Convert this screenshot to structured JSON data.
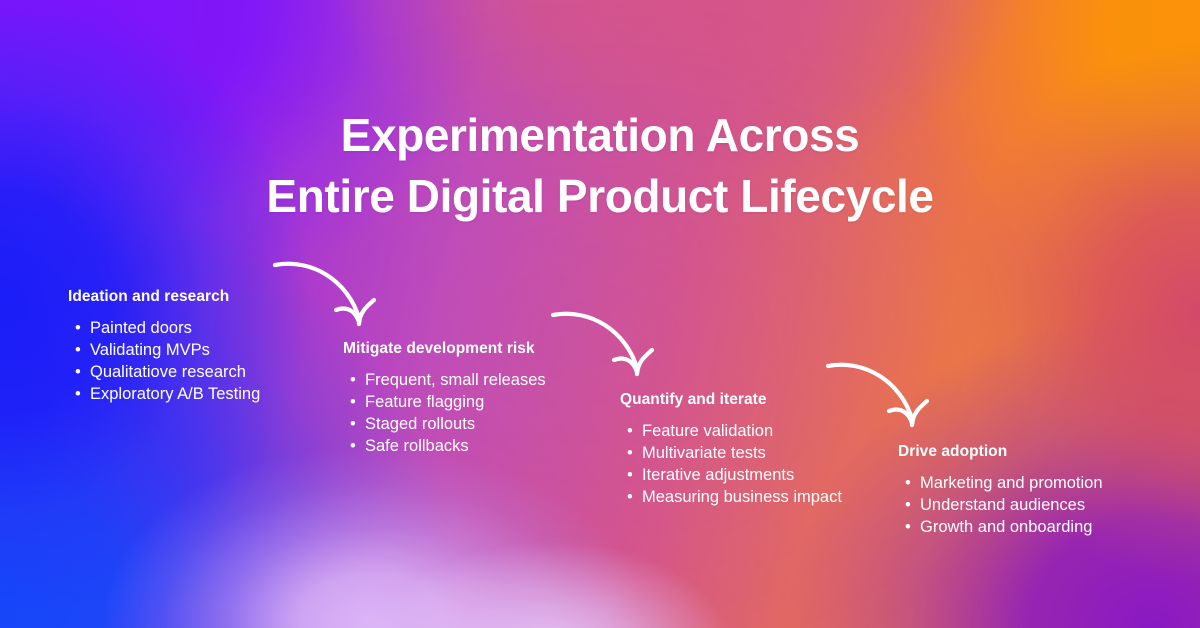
{
  "title": {
    "line1": "Experimentation Across",
    "line2": "Entire Digital Product Lifecycle",
    "full": "Experimentation Across\nEntire Digital Product Lifecycle"
  },
  "colors": {
    "text": "#ffffff",
    "arrow": "#ffffff",
    "bg_top_left_violet": "#7d14fb",
    "bg_top_center_pink": "#d5558a",
    "bg_top_right_orange": "#fb9209",
    "bg_mid_left_blue": "#1a1ef8",
    "bg_mid_center_magenta": "#b855d0",
    "bg_mid_right_rose": "#d2496b",
    "bg_bottom_left_blue": "#1348fa",
    "bg_bottom_center_lavender": "#dcb6f8",
    "bg_bottom_right_purple": "#8a18c4"
  },
  "stages": [
    {
      "heading": "Ideation and research",
      "bullet_glyph": "•",
      "items": [
        "Painted doors",
        "Validating MVPs",
        "Qualitatiove research",
        "Exploratory A/B Testing"
      ]
    },
    {
      "heading": "Mitigate development risk",
      "bullet_glyph": "•",
      "items": [
        "Frequent, small releases",
        "Feature flagging",
        "Staged rollouts",
        "Safe rollbacks"
      ]
    },
    {
      "heading": "Quantify and iterate",
      "bullet_glyph": "•",
      "items": [
        "Feature validation",
        "Multivariate tests",
        "Iterative adjustments",
        "Measuring business impact"
      ]
    },
    {
      "heading": "Drive adoption",
      "bullet_glyph": "•",
      "items": [
        "Marketing and promotion",
        "Understand audiences",
        "Growth and onboarding"
      ]
    }
  ],
  "arrows": [
    {
      "name": "arrow-ideation-to-mitigate",
      "from_stage": 0,
      "to_stage": 1
    },
    {
      "name": "arrow-mitigate-to-quantify",
      "from_stage": 1,
      "to_stage": 2
    },
    {
      "name": "arrow-quantify-to-adoption",
      "from_stage": 2,
      "to_stage": 3
    }
  ]
}
